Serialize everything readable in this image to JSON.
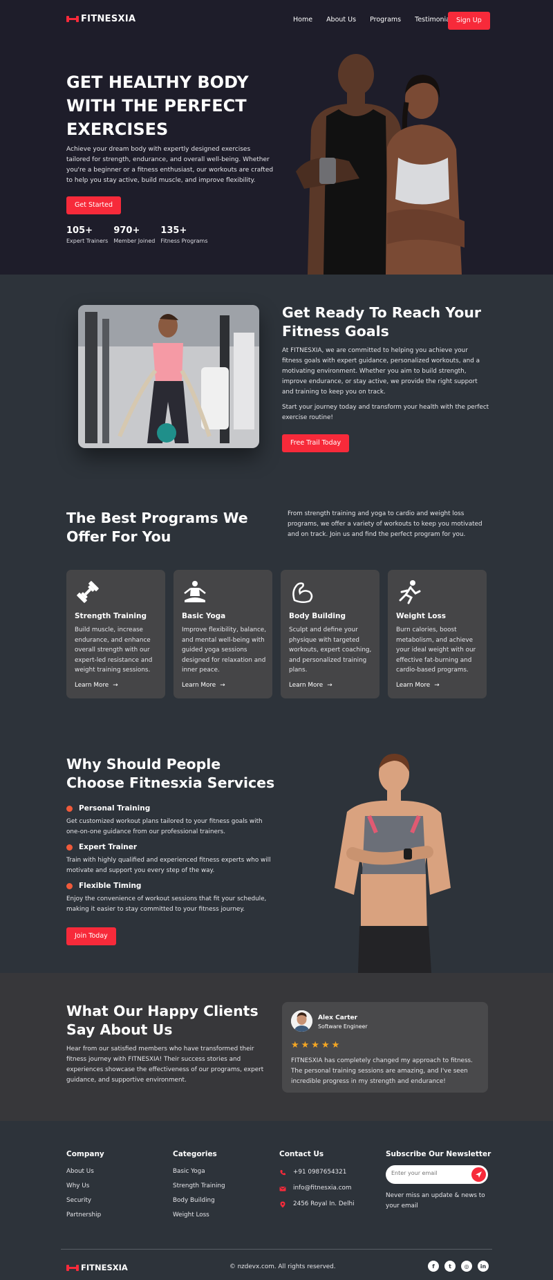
{
  "brand": {
    "name": "FITNESXIA"
  },
  "nav": {
    "items": [
      {
        "label": "Home"
      },
      {
        "label": "About Us"
      },
      {
        "label": "Programs"
      },
      {
        "label": "Testimonials"
      }
    ],
    "cta": "Sign Up"
  },
  "hero": {
    "title": "GET HEALTHY BODY WITH THE PERFECT EXERCISES",
    "text": "Achieve your dream body with expertly designed exercises tailored for strength, endurance, and overall well-being. Whether you're a beginner or a fitness enthusiast, our workouts are crafted to help you stay active, build muscle, and improve flexibility.",
    "cta": "Get Started",
    "stats": [
      {
        "value": "105+",
        "label": "Expert Trainers"
      },
      {
        "value": "970+",
        "label": "Member Joined"
      },
      {
        "value": "135+",
        "label": "Fitness Programs"
      }
    ]
  },
  "ready": {
    "title": "Get Ready To Reach Your Fitness Goals",
    "text1": "At FITNESXIA, we are committed to helping you achieve your fitness goals with expert guidance, personalized workouts, and a motivating environment. Whether you aim to build strength, improve endurance, or stay active, we provide the right support and training to keep you on track.",
    "text2": "Start your journey today and transform your health with the perfect exercise routine!",
    "cta": "Free Trail Today"
  },
  "programs": {
    "title": "The Best Programs We Offer For You",
    "intro": "From strength training and yoga to cardio and weight loss programs, we offer a variety of workouts to keep you motivated and on track. Join us and find the perfect program for you.",
    "cards": [
      {
        "title": "Strength Training",
        "text": "Build muscle, increase endurance, and enhance overall strength with our expert-led resistance and weight training sessions.",
        "link": "Learn More",
        "icon": "dumbbell-icon"
      },
      {
        "title": "Basic Yoga",
        "text": "Improve flexibility, balance, and mental well-being with guided yoga sessions designed for relaxation and inner peace.",
        "link": "Learn More",
        "icon": "yoga-icon"
      },
      {
        "title": "Body Building",
        "text": "Sculpt and define your physique with targeted workouts, expert coaching, and personalized training plans.",
        "link": "Learn More",
        "icon": "bicep-icon"
      },
      {
        "title": "Weight Loss",
        "text": "Burn calories, boost metabolism, and achieve your ideal weight with our effective fat-burning and cardio-based programs.",
        "link": "Learn More",
        "icon": "runner-icon"
      }
    ]
  },
  "why": {
    "title": "Why Should People Choose Fitnesxia Services",
    "features": [
      {
        "title": "Personal Training",
        "text": "Get customized workout plans tailored to your fitness goals with one-on-one guidance from our professional trainers."
      },
      {
        "title": "Expert Trainer",
        "text": "Train with highly qualified and experienced fitness experts who will motivate and support you every step of the way."
      },
      {
        "title": "Flexible Timing",
        "text": "Enjoy the convenience of workout sessions that fit your schedule, making it easier to stay committed to your fitness journey."
      }
    ],
    "cta": "Join Today"
  },
  "testimonials": {
    "title": "What Our Happy Clients Say About Us",
    "intro": "Hear from our satisfied members who have transformed their fitness journey with FITNESXIA! Their success stories and experiences showcase the effectiveness of our programs, expert guidance, and supportive environment.",
    "review": {
      "name": "Alex Carter",
      "role": "Software Engineer",
      "stars": "★★★★★",
      "rating": 5,
      "quote": "FITNESXIA has completely changed my approach to fitness. The personal training sessions are amazing, and I've seen incredible progress in my strength and endurance!"
    }
  },
  "footer": {
    "company": {
      "title": "Company",
      "items": [
        "About Us",
        "Why Us",
        "Security",
        "Partnership"
      ]
    },
    "categories": {
      "title": "Categories",
      "items": [
        "Basic Yoga",
        "Strength Training",
        "Body Building",
        "Weight Loss"
      ]
    },
    "contact": {
      "title": "Contact Us",
      "phone": "+91 0987654321",
      "email": "info@fitnesxia.com",
      "address": "2456 Royal In. Delhi"
    },
    "newsletter": {
      "title": "Subscribe Our Newsletter",
      "placeholder": "Enter your email",
      "note": "Never miss an update & news to your email"
    },
    "copyright": "© nzdevx.com. All rights reserved.",
    "socials": [
      {
        "icon": "facebook-icon",
        "glyph": "f"
      },
      {
        "icon": "twitter-icon",
        "glyph": "t"
      },
      {
        "icon": "instagram-icon",
        "glyph": "◎"
      },
      {
        "icon": "linkedin-icon",
        "glyph": "in"
      }
    ]
  },
  "colors": {
    "accent": "#f72a3a",
    "dark": "#1e1d2a",
    "section": "#2d333a",
    "card": "#454547",
    "star": "#f4a623"
  }
}
